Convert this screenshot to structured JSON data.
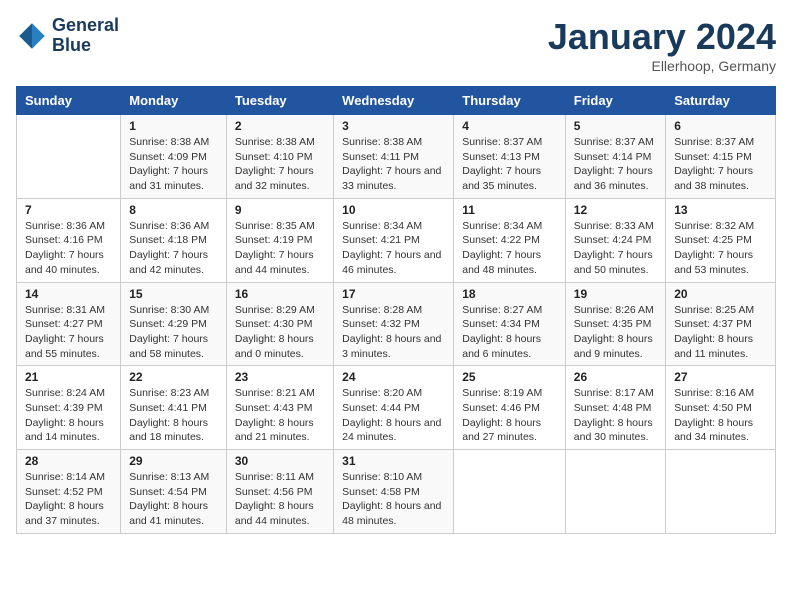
{
  "header": {
    "logo_line1": "General",
    "logo_line2": "Blue",
    "month": "January 2024",
    "location": "Ellerhoop, Germany"
  },
  "days_of_week": [
    "Sunday",
    "Monday",
    "Tuesday",
    "Wednesday",
    "Thursday",
    "Friday",
    "Saturday"
  ],
  "weeks": [
    [
      {
        "day": "",
        "sunrise": "",
        "sunset": "",
        "daylight": ""
      },
      {
        "day": "1",
        "sunrise": "Sunrise: 8:38 AM",
        "sunset": "Sunset: 4:09 PM",
        "daylight": "Daylight: 7 hours and 31 minutes."
      },
      {
        "day": "2",
        "sunrise": "Sunrise: 8:38 AM",
        "sunset": "Sunset: 4:10 PM",
        "daylight": "Daylight: 7 hours and 32 minutes."
      },
      {
        "day": "3",
        "sunrise": "Sunrise: 8:38 AM",
        "sunset": "Sunset: 4:11 PM",
        "daylight": "Daylight: 7 hours and 33 minutes."
      },
      {
        "day": "4",
        "sunrise": "Sunrise: 8:37 AM",
        "sunset": "Sunset: 4:13 PM",
        "daylight": "Daylight: 7 hours and 35 minutes."
      },
      {
        "day": "5",
        "sunrise": "Sunrise: 8:37 AM",
        "sunset": "Sunset: 4:14 PM",
        "daylight": "Daylight: 7 hours and 36 minutes."
      },
      {
        "day": "6",
        "sunrise": "Sunrise: 8:37 AM",
        "sunset": "Sunset: 4:15 PM",
        "daylight": "Daylight: 7 hours and 38 minutes."
      }
    ],
    [
      {
        "day": "7",
        "sunrise": "Sunrise: 8:36 AM",
        "sunset": "Sunset: 4:16 PM",
        "daylight": "Daylight: 7 hours and 40 minutes."
      },
      {
        "day": "8",
        "sunrise": "Sunrise: 8:36 AM",
        "sunset": "Sunset: 4:18 PM",
        "daylight": "Daylight: 7 hours and 42 minutes."
      },
      {
        "day": "9",
        "sunrise": "Sunrise: 8:35 AM",
        "sunset": "Sunset: 4:19 PM",
        "daylight": "Daylight: 7 hours and 44 minutes."
      },
      {
        "day": "10",
        "sunrise": "Sunrise: 8:34 AM",
        "sunset": "Sunset: 4:21 PM",
        "daylight": "Daylight: 7 hours and 46 minutes."
      },
      {
        "day": "11",
        "sunrise": "Sunrise: 8:34 AM",
        "sunset": "Sunset: 4:22 PM",
        "daylight": "Daylight: 7 hours and 48 minutes."
      },
      {
        "day": "12",
        "sunrise": "Sunrise: 8:33 AM",
        "sunset": "Sunset: 4:24 PM",
        "daylight": "Daylight: 7 hours and 50 minutes."
      },
      {
        "day": "13",
        "sunrise": "Sunrise: 8:32 AM",
        "sunset": "Sunset: 4:25 PM",
        "daylight": "Daylight: 7 hours and 53 minutes."
      }
    ],
    [
      {
        "day": "14",
        "sunrise": "Sunrise: 8:31 AM",
        "sunset": "Sunset: 4:27 PM",
        "daylight": "Daylight: 7 hours and 55 minutes."
      },
      {
        "day": "15",
        "sunrise": "Sunrise: 8:30 AM",
        "sunset": "Sunset: 4:29 PM",
        "daylight": "Daylight: 7 hours and 58 minutes."
      },
      {
        "day": "16",
        "sunrise": "Sunrise: 8:29 AM",
        "sunset": "Sunset: 4:30 PM",
        "daylight": "Daylight: 8 hours and 0 minutes."
      },
      {
        "day": "17",
        "sunrise": "Sunrise: 8:28 AM",
        "sunset": "Sunset: 4:32 PM",
        "daylight": "Daylight: 8 hours and 3 minutes."
      },
      {
        "day": "18",
        "sunrise": "Sunrise: 8:27 AM",
        "sunset": "Sunset: 4:34 PM",
        "daylight": "Daylight: 8 hours and 6 minutes."
      },
      {
        "day": "19",
        "sunrise": "Sunrise: 8:26 AM",
        "sunset": "Sunset: 4:35 PM",
        "daylight": "Daylight: 8 hours and 9 minutes."
      },
      {
        "day": "20",
        "sunrise": "Sunrise: 8:25 AM",
        "sunset": "Sunset: 4:37 PM",
        "daylight": "Daylight: 8 hours and 11 minutes."
      }
    ],
    [
      {
        "day": "21",
        "sunrise": "Sunrise: 8:24 AM",
        "sunset": "Sunset: 4:39 PM",
        "daylight": "Daylight: 8 hours and 14 minutes."
      },
      {
        "day": "22",
        "sunrise": "Sunrise: 8:23 AM",
        "sunset": "Sunset: 4:41 PM",
        "daylight": "Daylight: 8 hours and 18 minutes."
      },
      {
        "day": "23",
        "sunrise": "Sunrise: 8:21 AM",
        "sunset": "Sunset: 4:43 PM",
        "daylight": "Daylight: 8 hours and 21 minutes."
      },
      {
        "day": "24",
        "sunrise": "Sunrise: 8:20 AM",
        "sunset": "Sunset: 4:44 PM",
        "daylight": "Daylight: 8 hours and 24 minutes."
      },
      {
        "day": "25",
        "sunrise": "Sunrise: 8:19 AM",
        "sunset": "Sunset: 4:46 PM",
        "daylight": "Daylight: 8 hours and 27 minutes."
      },
      {
        "day": "26",
        "sunrise": "Sunrise: 8:17 AM",
        "sunset": "Sunset: 4:48 PM",
        "daylight": "Daylight: 8 hours and 30 minutes."
      },
      {
        "day": "27",
        "sunrise": "Sunrise: 8:16 AM",
        "sunset": "Sunset: 4:50 PM",
        "daylight": "Daylight: 8 hours and 34 minutes."
      }
    ],
    [
      {
        "day": "28",
        "sunrise": "Sunrise: 8:14 AM",
        "sunset": "Sunset: 4:52 PM",
        "daylight": "Daylight: 8 hours and 37 minutes."
      },
      {
        "day": "29",
        "sunrise": "Sunrise: 8:13 AM",
        "sunset": "Sunset: 4:54 PM",
        "daylight": "Daylight: 8 hours and 41 minutes."
      },
      {
        "day": "30",
        "sunrise": "Sunrise: 8:11 AM",
        "sunset": "Sunset: 4:56 PM",
        "daylight": "Daylight: 8 hours and 44 minutes."
      },
      {
        "day": "31",
        "sunrise": "Sunrise: 8:10 AM",
        "sunset": "Sunset: 4:58 PM",
        "daylight": "Daylight: 8 hours and 48 minutes."
      },
      {
        "day": "",
        "sunrise": "",
        "sunset": "",
        "daylight": ""
      },
      {
        "day": "",
        "sunrise": "",
        "sunset": "",
        "daylight": ""
      },
      {
        "day": "",
        "sunrise": "",
        "sunset": "",
        "daylight": ""
      }
    ]
  ]
}
